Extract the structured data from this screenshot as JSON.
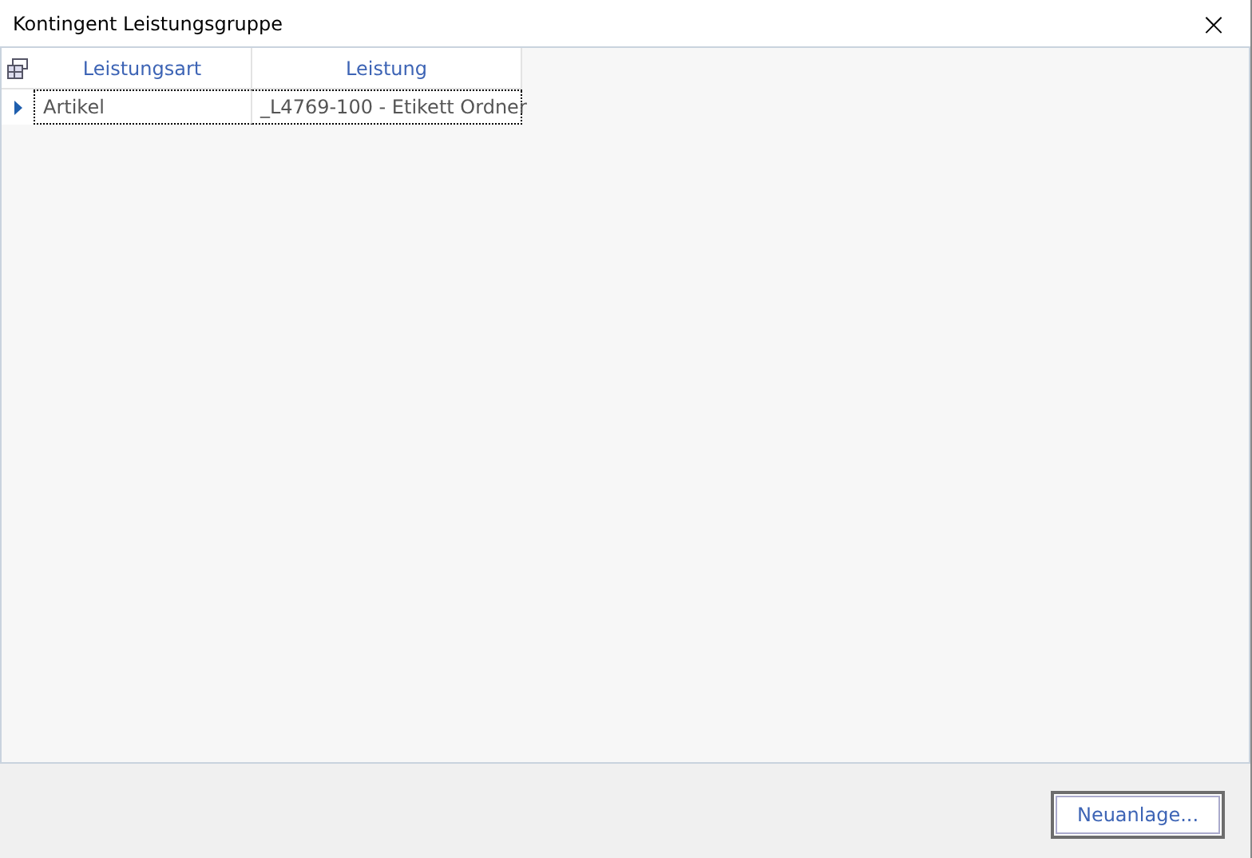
{
  "window": {
    "title": "Kontingent Leistungsgruppe",
    "close": "×"
  },
  "table": {
    "columns": [
      "Leistungsart",
      "Leistung"
    ],
    "rows": [
      {
        "cells": [
          "Artikel",
          "_L4769-100 - Etikett Ordner"
        ],
        "current": true
      }
    ]
  },
  "buttons": [
    "Neuanlage..."
  ]
}
